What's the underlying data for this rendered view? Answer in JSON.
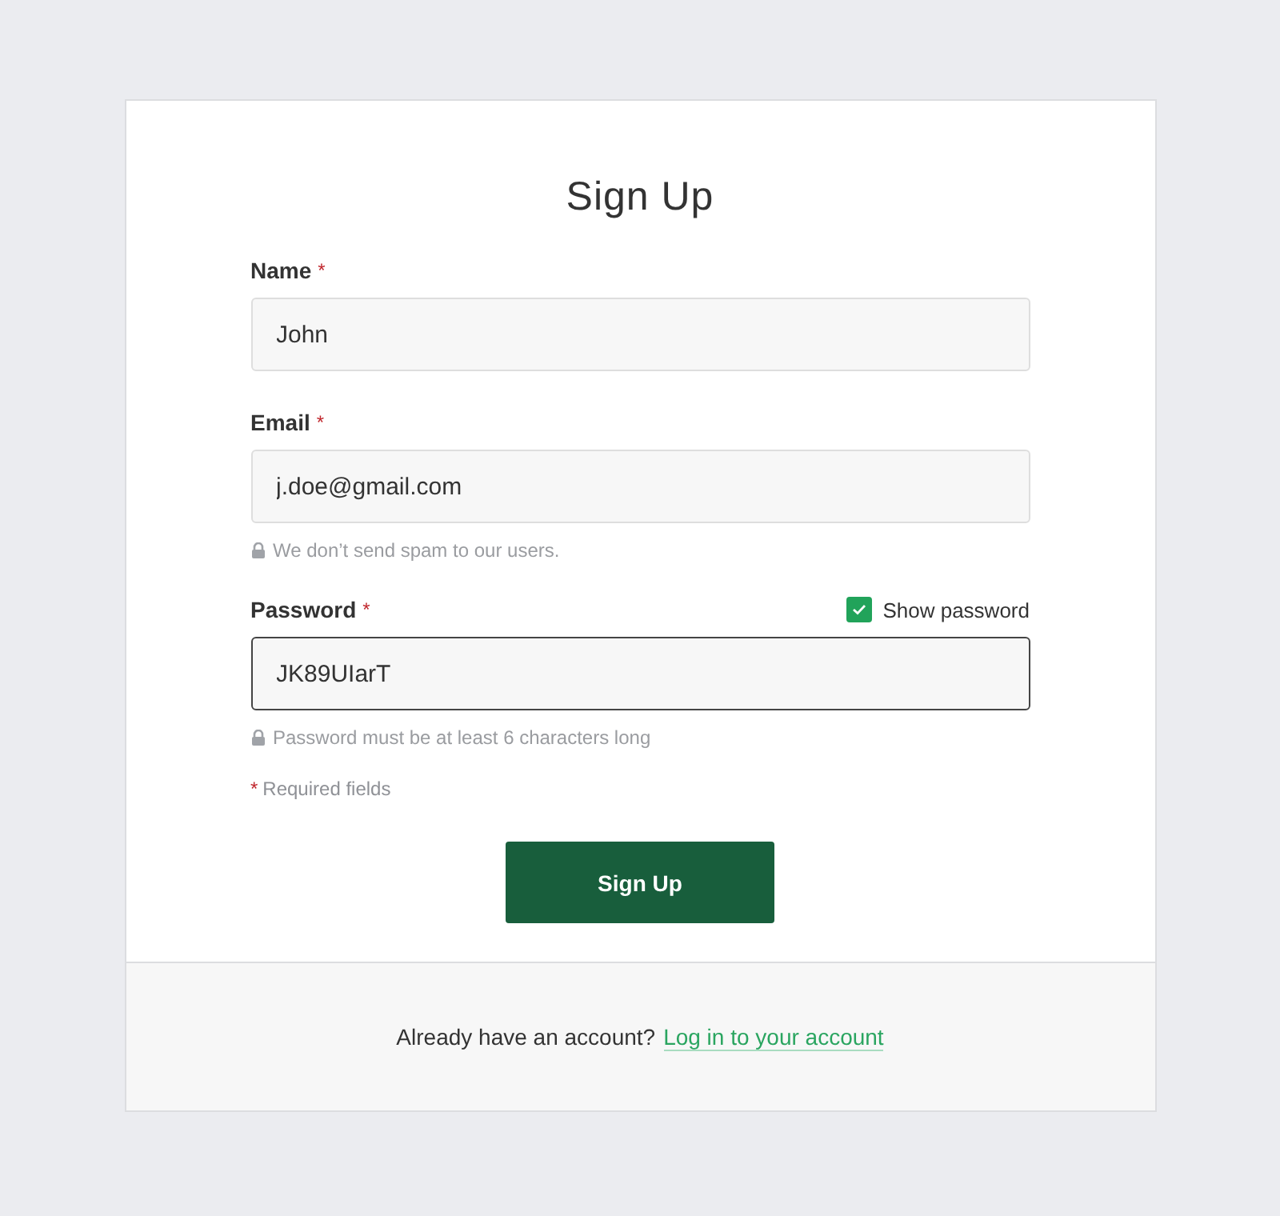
{
  "title": "Sign Up",
  "fields": [
    {
      "label": "Name",
      "required_mark": "*",
      "value": "John",
      "focused": false
    },
    {
      "label": "Email",
      "required_mark": "*",
      "value": "j.doe@gmail.com",
      "focused": false,
      "hint": "We don’t send spam to our users."
    },
    {
      "label": "Password",
      "required_mark": "*",
      "value": "JK89UIarT",
      "focused": true,
      "hint": "Password must be at least 6 characters long",
      "toggle": {
        "label": "Show password",
        "checked": true
      }
    }
  ],
  "required_note": {
    "mark": "*",
    "text": "Required fields"
  },
  "submit": "Sign Up",
  "footer": {
    "text": "Already have an account?",
    "link": "Log in to your account"
  }
}
